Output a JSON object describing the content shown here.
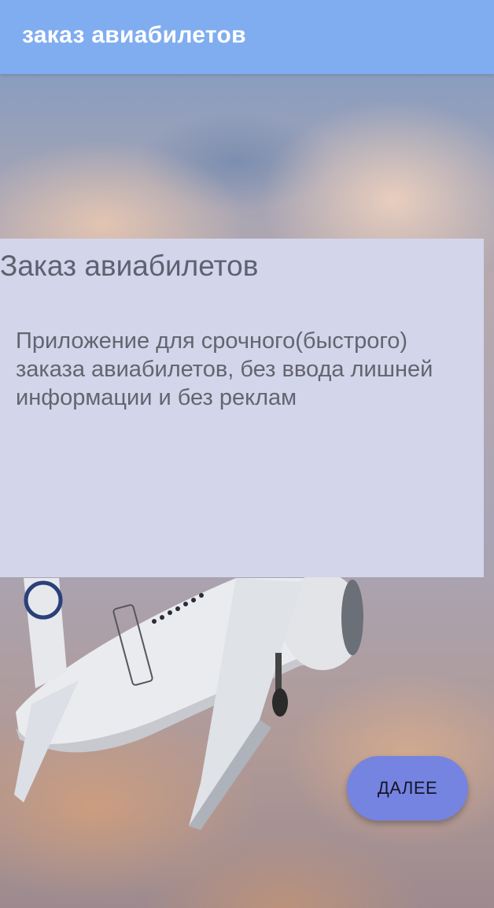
{
  "appbar": {
    "title": "заказ авиабилетов"
  },
  "card": {
    "title": "Заказ авиабилетов",
    "description": "Приложение для срочного(быстрого) заказа авиабилетов, без ввода лишней информации и без реклам"
  },
  "actions": {
    "next_label": "ДАЛЕЕ"
  },
  "colors": {
    "appbar": "#80adf0",
    "card": "#d3d5ea",
    "button": "#7584e0"
  }
}
